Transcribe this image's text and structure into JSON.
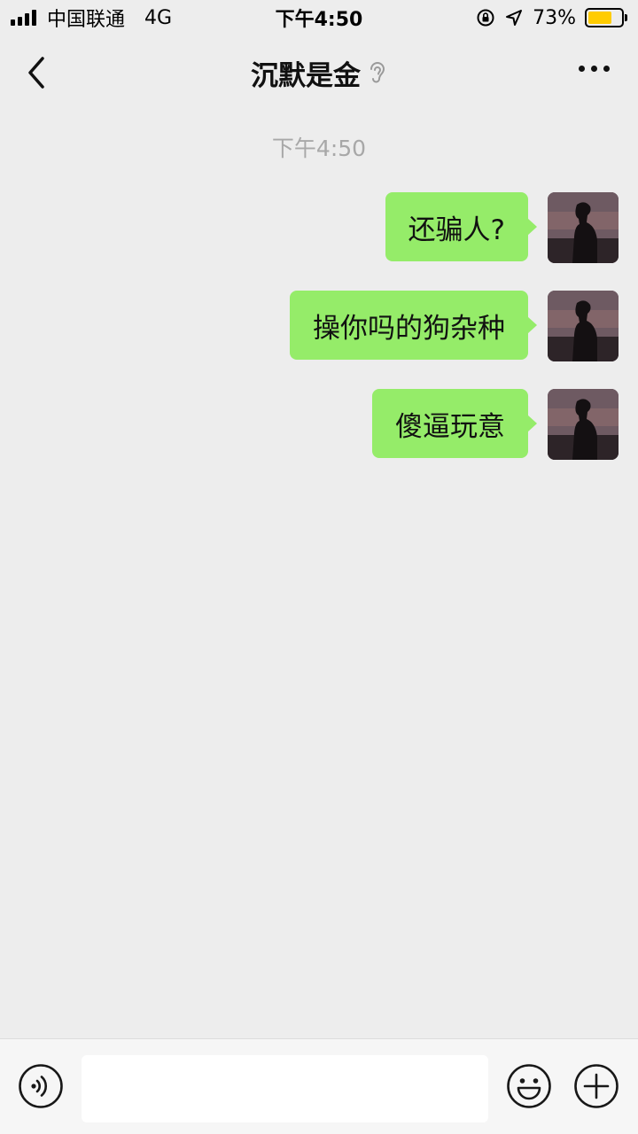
{
  "status_bar": {
    "carrier": "中国联通",
    "network": "4G",
    "time": "下午4:50",
    "battery": "73%",
    "battery_level": 0.73,
    "battery_color": "#ffcc00"
  },
  "nav": {
    "title": "沉默是金"
  },
  "chat": {
    "timestamp": "下午4:50",
    "bubble_color": "#95ec69",
    "messages": [
      {
        "text": "还骗人?",
        "sender": "self"
      },
      {
        "text": "操你吗的狗杂种",
        "sender": "self"
      },
      {
        "text": "傻逼玩意",
        "sender": "self"
      }
    ]
  },
  "input_bar": {
    "text": ""
  }
}
